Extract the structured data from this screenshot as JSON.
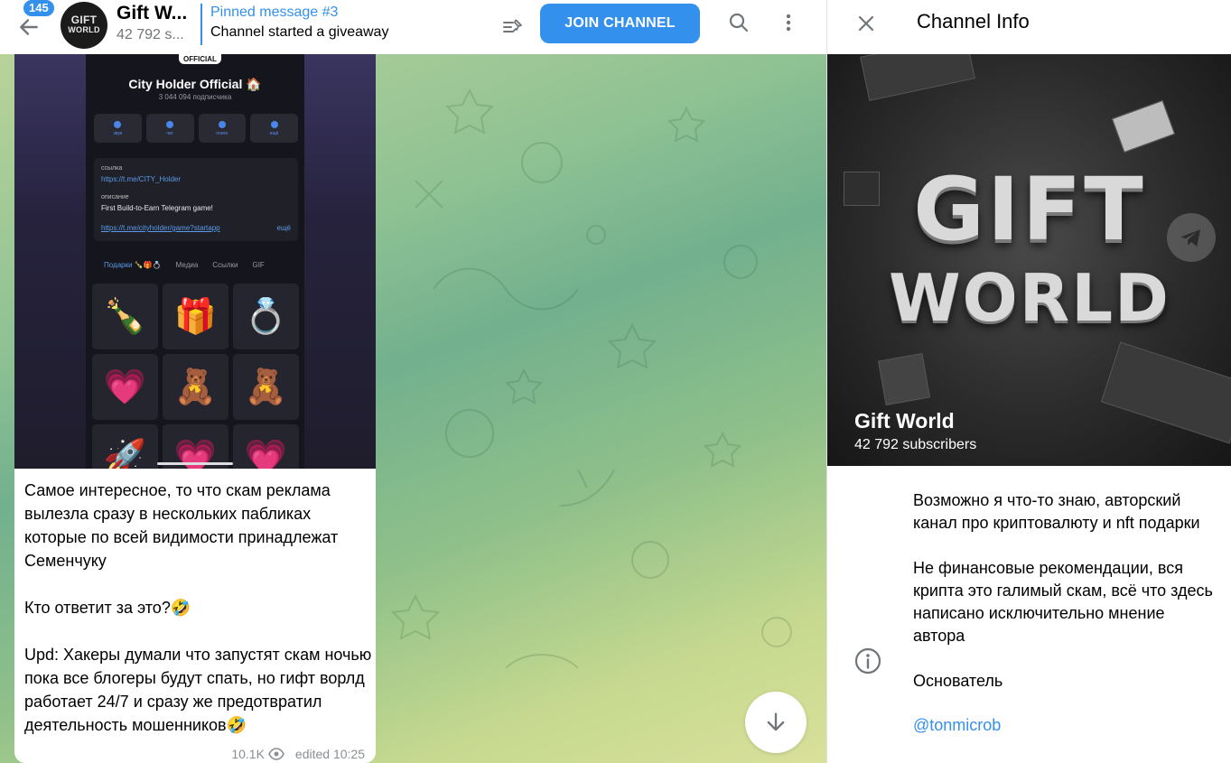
{
  "header": {
    "unread_count": "145",
    "avatar_text_line1": "GIFT",
    "avatar_text_line2": "WORLD",
    "title": "Gift W...",
    "subtitle": "42 792 s...",
    "pinned_title": "Pinned message #3",
    "pinned_text": "Channel started a giveaway",
    "join_label": "JOIN CHANNEL",
    "icons": [
      "back-arrow-icon",
      "pin-list-icon",
      "search-icon",
      "more-vertical-icon"
    ]
  },
  "message": {
    "screenshot": {
      "official": "OFFICIAL",
      "title": "City Holder Official 🏠",
      "subscribers": "3 044 094 подписчика",
      "actions": [
        "звук",
        "чат",
        "поиск",
        "ещё"
      ],
      "link_label": "ссылка",
      "link": "https://t.me/CITY_Holder",
      "desc_label": "описание",
      "desc": "First Build-to-Earn Telegram game!",
      "app_link": "https://t.me/cityholder/game?startapp",
      "more": "ещё",
      "tabs": [
        "Подарки 🍾🎁💍",
        "Медиа",
        "Ссылки",
        "GIF"
      ],
      "gifts": [
        "🍾",
        "🎁",
        "💍",
        "💗",
        "🧸",
        "🧸",
        "🚀",
        "💗",
        "💗"
      ]
    },
    "text": "Самое интересное, то что скам реклама вылезла сразу в нескольких пабликах которые по всей видимости принадлежат Семенчуку\n\nКто ответит за это?🤣\n\nUpd: Хакеры думали что запустят скам ночью пока все блогеры будут спать, но гифт ворлд работает 24/7 и сразу же предотвратил деятельность мошенников🤣",
    "views": "10.1K",
    "edited": "edited 10:25"
  },
  "panel": {
    "title": "Channel Info",
    "cover_word1": "GIFT",
    "cover_word2": "WORLD",
    "channel_name": "Gift World",
    "subscribers": "42 792 subscribers",
    "about": "Возможно я что-то знаю, авторский канал про криптовалюту и nft подарки\n\nНе финансовые рекомендации, вся крипта это галимый скам, всё что здесь написано исключительно мнение автора\n\nОснователь",
    "founder_link": "@tonmicrob"
  },
  "colors": {
    "accent": "#3390ec",
    "secondary_text": "#707579"
  }
}
